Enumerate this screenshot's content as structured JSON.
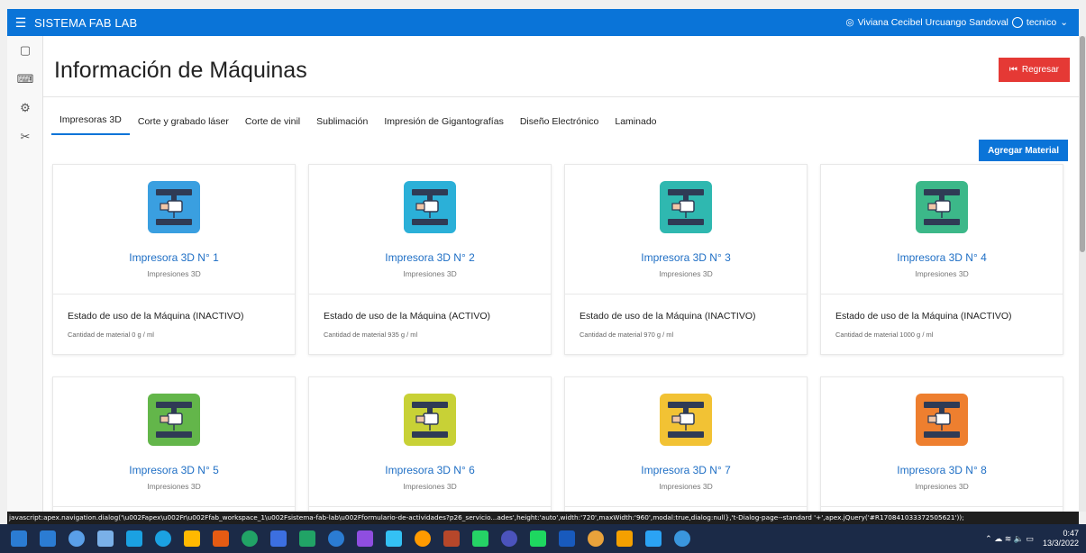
{
  "app": {
    "title": "SISTEMA FAB LAB",
    "user_full": "Viviana Cecibel Urcuango Sandoval",
    "role": "tecnico"
  },
  "page": {
    "title": "Información de Máquinas",
    "back_label": "Regresar",
    "add_label": "Agregar Material"
  },
  "tabs": [
    {
      "label": "Impresoras 3D",
      "active": true
    },
    {
      "label": "Corte y grabado láser"
    },
    {
      "label": "Corte de vinil"
    },
    {
      "label": "Sublimación"
    },
    {
      "label": "Impresión de Gigantografías"
    },
    {
      "label": "Diseño Electrónico"
    },
    {
      "label": "Laminado"
    }
  ],
  "cards": [
    {
      "name": "Impresora 3D N° 1",
      "category": "Impresiones 3D",
      "state": "Estado de uso de la Máquina (INACTIVO)",
      "qty": "Cantidad de material 0 g / ml",
      "color": "#3a9fe0"
    },
    {
      "name": "Impresora 3D N° 2",
      "category": "Impresiones 3D",
      "state": "Estado de uso de la Máquina (ACTIVO)",
      "qty": "Cantidad de material 935 g / ml",
      "color": "#2bb0d8"
    },
    {
      "name": "Impresora 3D N° 3",
      "category": "Impresiones 3D",
      "state": "Estado de uso de la Máquina (INACTIVO)",
      "qty": "Cantidad de material 970 g / ml",
      "color": "#2fb8b0"
    },
    {
      "name": "Impresora 3D N° 4",
      "category": "Impresiones 3D",
      "state": "Estado de uso de la Máquina (INACTIVO)",
      "qty": "Cantidad de material 1000 g / ml",
      "color": "#3cb889"
    },
    {
      "name": "Impresora 3D N° 5",
      "category": "Impresiones 3D",
      "color": "#63b64a"
    },
    {
      "name": "Impresora 3D N° 6",
      "category": "Impresiones 3D",
      "color": "#c8d136"
    },
    {
      "name": "Impresora 3D N° 7",
      "category": "Impresiones 3D",
      "color": "#f2c234"
    },
    {
      "name": "Impresora 3D N° 8",
      "category": "Impresiones 3D",
      "color": "#ee7f2f"
    }
  ],
  "statusbar": "javascript:apex.navigation.dialog('\\u002Fapex\\u002Fr\\u002Ffab_workspace_1\\u002Fsistema-fab-lab\\u002Fformulario-de-actividades?p26_servicio...ades',height:'auto',width:'720',maxWidth:'960',modal:true,dialog:null},'t-Dialog-page--standard '+',apex.jQuery('#R170841033372505621'));",
  "clock": {
    "time": "0:47",
    "date": "13/3/2022"
  },
  "taskbar_colors": [
    "#2b7cd3",
    "#5a9fe8",
    "#7ab0e8",
    "#1ba1e2",
    "#1ba1e2",
    "#ffb900",
    "#e55b13",
    "#21a366",
    "#3c6fe0",
    "#21a366",
    "#2b7cd3",
    "#8f4ee0",
    "#34c1f4",
    "#ff9a00",
    "#b7472a",
    "#25d366",
    "#4b53bc",
    "#1ed760",
    "#185abd",
    "#e9a23b",
    "#f4a000",
    "#2ba3f4",
    "#3a96dd"
  ]
}
